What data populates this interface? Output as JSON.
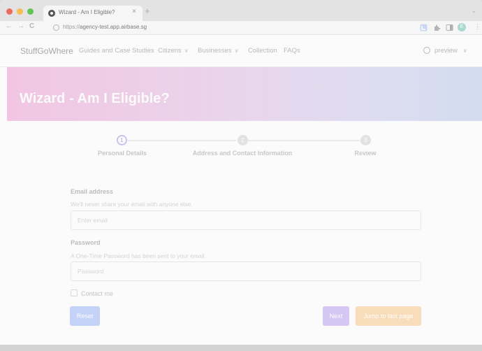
{
  "browser": {
    "tab_title": "Wizard - Am I Eligible?",
    "tab_close": "×",
    "new_tab": "+",
    "tabs_menu": "⌄",
    "nav": {
      "back": "←",
      "forward": "→",
      "reload": "C"
    },
    "url_scheme": "https://",
    "url_host": "agency-test.app.airbase.sg",
    "toolbar": {
      "profile_initial": "E",
      "menu": "⋮"
    },
    "colors": {
      "traffic_red": "#ed6a5e",
      "traffic_yellow": "#f5bf4f",
      "traffic_green": "#62c554"
    }
  },
  "navbar": {
    "brand": "StuffGoWhere",
    "links": [
      {
        "label": "Guides and Case Studies",
        "dropdown": false
      },
      {
        "label": "Citizens",
        "dropdown": true
      },
      {
        "label": "Businesses",
        "dropdown": true
      },
      {
        "label": "Collection",
        "dropdown": false
      },
      {
        "label": "FAQs",
        "dropdown": false
      }
    ],
    "dropdown_chevron": "∨",
    "user": {
      "label": "preview",
      "icon": "user-icon"
    }
  },
  "hero": {
    "title": "Wizard - Am I Eligible?"
  },
  "stepper": {
    "steps": [
      {
        "number": "1",
        "label": "Personal Details",
        "state": "active"
      },
      {
        "number": "2",
        "label": "Address and Contact Information",
        "state": "todo"
      },
      {
        "number": "3",
        "label": "Review",
        "state": "todo"
      }
    ]
  },
  "form": {
    "email": {
      "label": "Email address",
      "help": "We'll never share your email with anyone else.",
      "placeholder": "Enter email",
      "value": ""
    },
    "password": {
      "label": "Password",
      "help": "A One-Time Password has been sent to your email.",
      "placeholder": "Password",
      "value": ""
    },
    "contact": {
      "label": "Contact me",
      "checked": false
    },
    "buttons": {
      "reset": "Reset",
      "next": "Next",
      "jump": "Jump to last page"
    }
  }
}
